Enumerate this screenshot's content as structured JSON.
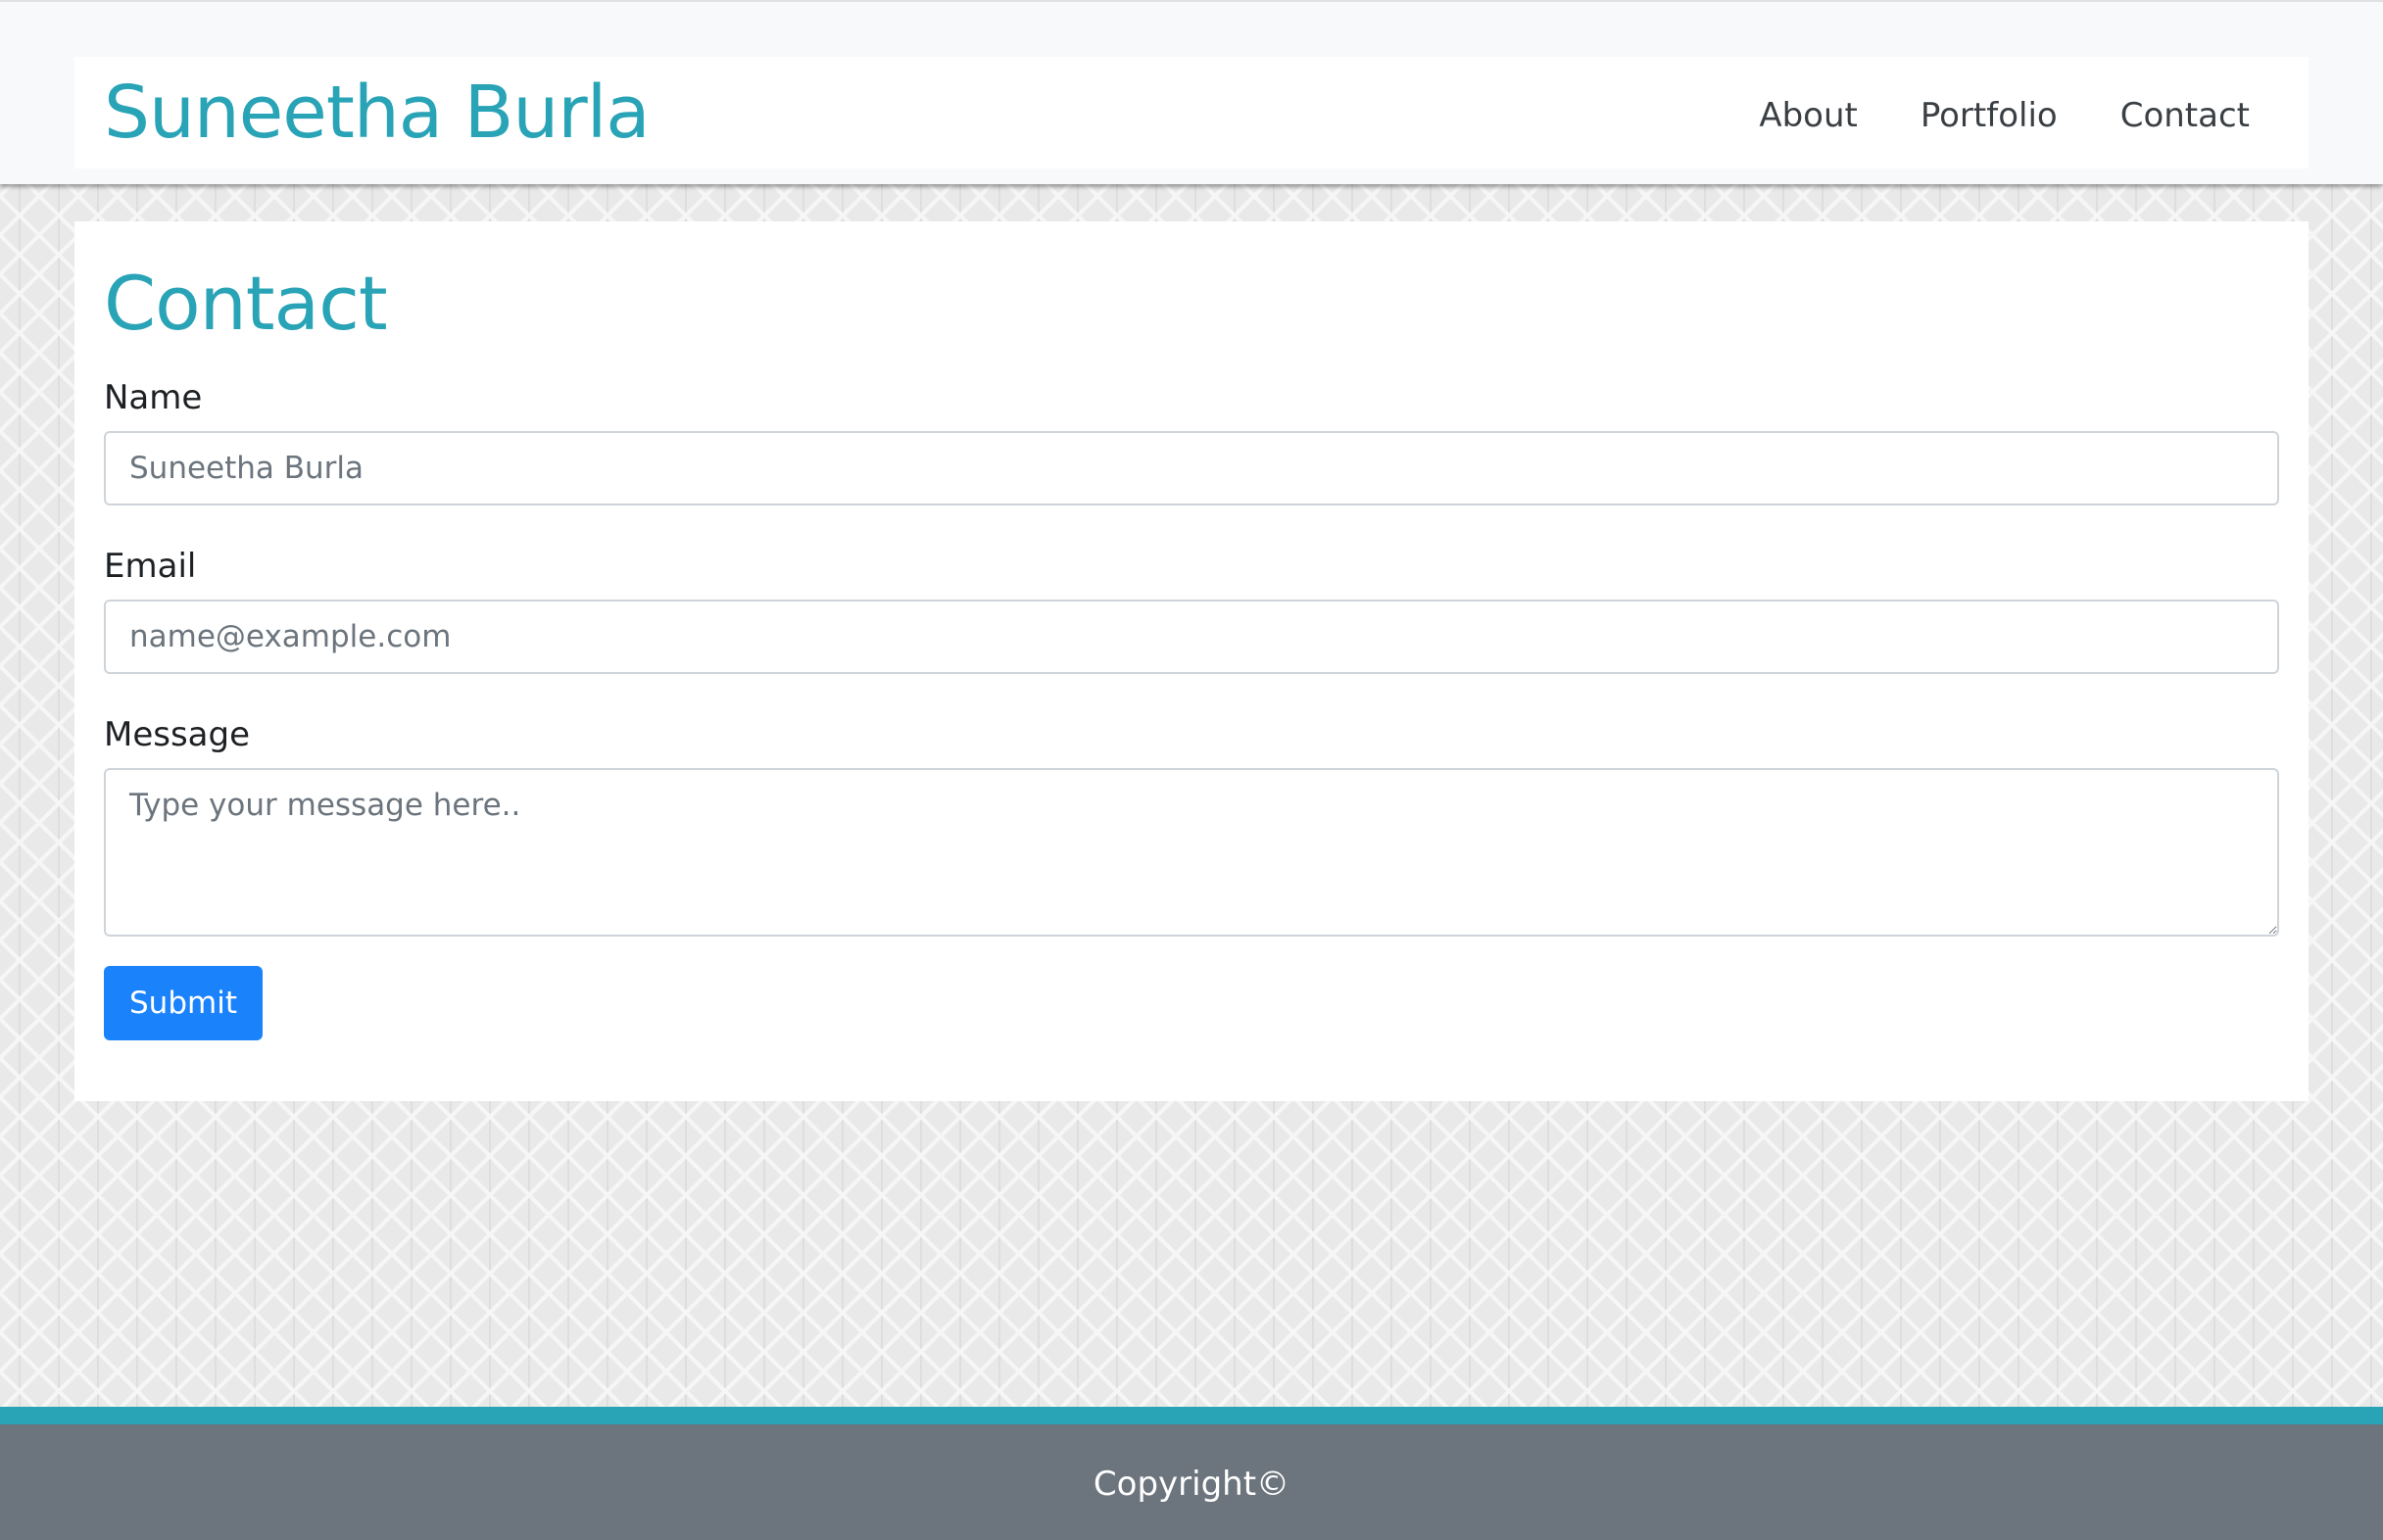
{
  "header": {
    "brand": "Suneetha Burla",
    "nav": [
      {
        "label": "About"
      },
      {
        "label": "Portfolio"
      },
      {
        "label": "Contact"
      }
    ]
  },
  "main": {
    "title": "Contact",
    "form": {
      "name_label": "Name",
      "name_value": "",
      "name_placeholder": "Suneetha Burla",
      "email_label": "Email",
      "email_value": "",
      "email_placeholder": "name@example.com",
      "message_label": "Message",
      "message_value": "",
      "message_placeholder": "Type your message here..",
      "submit_label": "Submit"
    }
  },
  "footer": {
    "copyright": "Copyright©"
  },
  "colors": {
    "brand": "#29a3b6",
    "button": "#1a82fb",
    "footer_bg": "#6c757d",
    "footer_border": "#29a3b6"
  }
}
